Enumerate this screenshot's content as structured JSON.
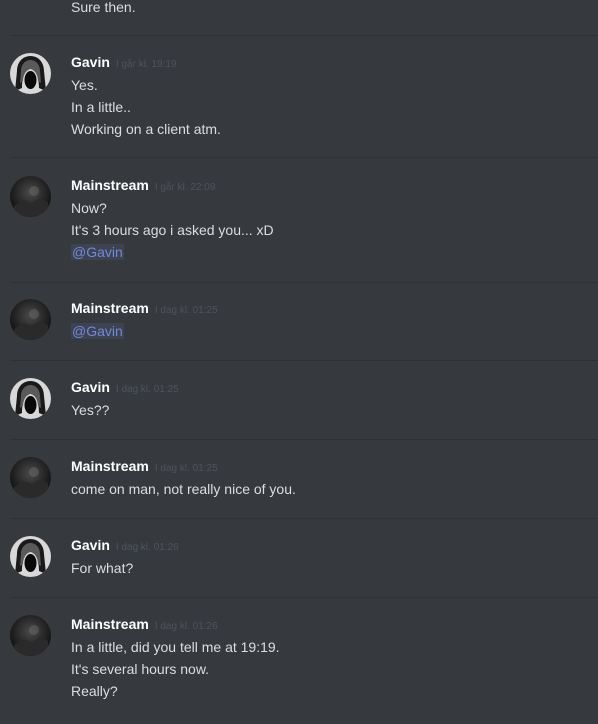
{
  "top_message": "Sure then.",
  "colors": {
    "background": "#36393e",
    "divider": "#2f3136",
    "username": "#ffffff",
    "text": "#dcddde",
    "timestamp": "#4f545c",
    "mention": "#7289da"
  },
  "messages": [
    {
      "author": "Gavin",
      "avatar": "gavin-avatar-icon",
      "timestamp": "I går kl. 19:19",
      "lines": [
        "Yes.",
        "In a little..",
        "Working on a client atm."
      ]
    },
    {
      "author": "Mainstream",
      "avatar": "mainstream-avatar-icon",
      "timestamp": "I går kl. 22:09",
      "lines": [
        "Now?",
        "It's 3 hours ago i asked you... xD"
      ],
      "mention": "@Gavin"
    },
    {
      "author": "Mainstream",
      "avatar": "mainstream-avatar-icon",
      "timestamp": "I dag kl. 01:25",
      "lines": [],
      "mention": "@Gavin"
    },
    {
      "author": "Gavin",
      "avatar": "gavin-avatar-icon",
      "timestamp": "I dag kl. 01:25",
      "lines": [
        "Yes??"
      ]
    },
    {
      "author": "Mainstream",
      "avatar": "mainstream-avatar-icon",
      "timestamp": "I dag kl. 01:25",
      "lines": [
        "come on man, not really nice of you."
      ]
    },
    {
      "author": "Gavin",
      "avatar": "gavin-avatar-icon",
      "timestamp": "I dag kl. 01:26",
      "lines": [
        "For what?"
      ]
    },
    {
      "author": "Mainstream",
      "avatar": "mainstream-avatar-icon",
      "timestamp": "I dag kl. 01:26",
      "lines": [
        "In a little, did you tell me at 19:19.",
        "It's several hours now.",
        "Really?"
      ]
    }
  ]
}
